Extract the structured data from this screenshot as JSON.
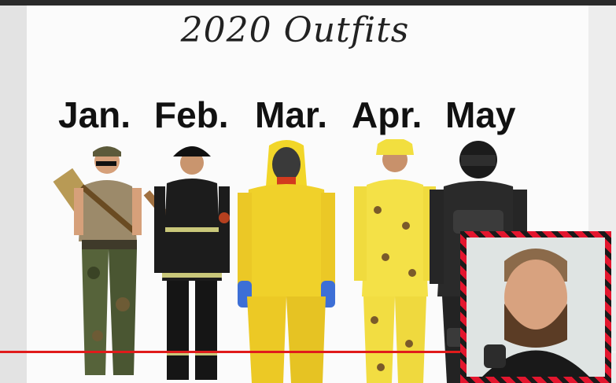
{
  "slide": {
    "title": "2020 Outfits",
    "months": [
      "Jan.",
      "Feb.",
      "Mar.",
      "Apr.",
      "May"
    ]
  },
  "player": {
    "progress_fraction": 0.87,
    "progress_color": "#e01b1b"
  },
  "icons": [
    "webcam-overlay"
  ]
}
